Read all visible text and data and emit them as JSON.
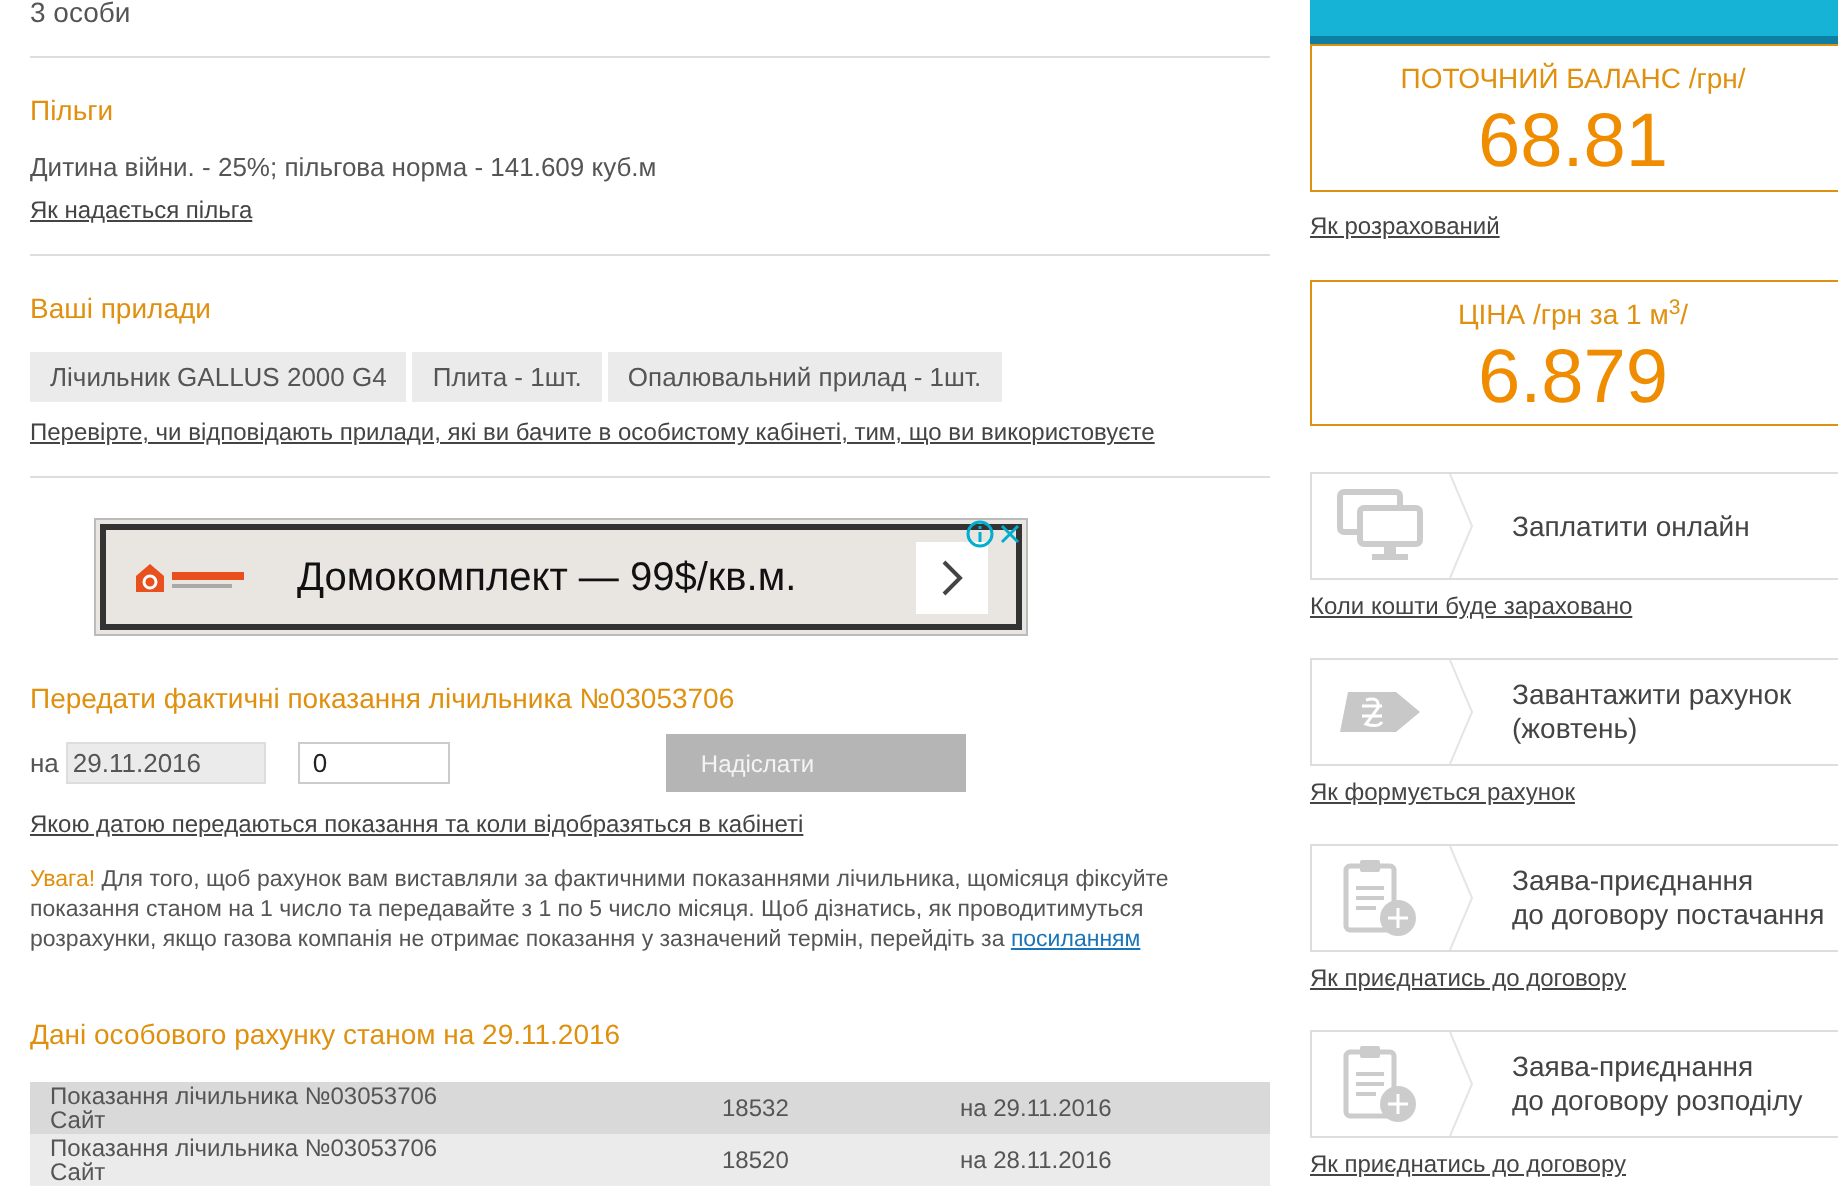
{
  "household": {
    "text": "3 особи"
  },
  "benefits": {
    "title": "Пільги",
    "text": "Дитина війни. - 25%; пільгова норма - 141.609 куб.м",
    "link": "Як надається пільга"
  },
  "devices": {
    "title": "Ваші прилади",
    "items": [
      "Лічильник GALLUS 2000 G4",
      "Плита - 1шт.",
      "Опалювальний прилад - 1шт."
    ],
    "link": "Перевірте, чи відповідають прилади, які ви бачите в особистому кабінеті, тим, що ви використовуєте"
  },
  "ad": {
    "text": "Домокомплект — 99$/кв.м."
  },
  "reading_form": {
    "title": "Передати фактичні показання лічильника №03053706",
    "date_label": "на",
    "date": "29.11.2016",
    "value": "0",
    "button": "Надіслати",
    "button_disabled": true,
    "link": "Якою датою передаються показання та коли відобразяться в кабінеті"
  },
  "warning": {
    "label": "Увага!",
    "text": " Для того, щоб рахунок вам виставляли за фактичними показаннями лічильника, щомісяця фіксуйте показання станом на 1 число та передавайте з 1 по 5 число місяця. Щоб дізнатись, як проводитимуться розрахунки, якщо газова компанія не отримає показання у зазначений термін, перейдіть за ",
    "link": "посиланням"
  },
  "account": {
    "title": "Дані особового рахунку станом на 29.11.2016",
    "rows": [
      {
        "meter": "Показання лічильника №03053706",
        "source": "Сайт",
        "reading": "18532",
        "date": "на 29.11.2016"
      },
      {
        "meter": "Показання лічильника №03053706",
        "source": "Сайт",
        "reading": "18520",
        "date": "на 28.11.2016"
      }
    ]
  },
  "balance": {
    "label": "ПОТОЧНИЙ БАЛАНС /грн/",
    "value": "68.81",
    "link": "Як розрахований"
  },
  "price": {
    "label": "ЦІНА /грн за 1 м$^{3}$/",
    "value": "6.879"
  },
  "actions": [
    {
      "kind": "monitor",
      "label": [
        "Заплатити онлайн"
      ],
      "link": "Коли кошти буде зараховано"
    },
    {
      "kind": "currency",
      "label": [
        "Завантажити рахунок",
        "(жовтень)"
      ],
      "link": "Як формується рахунок"
    },
    {
      "kind": "clipboard",
      "label": [
        "Заява-приєднання",
        "до договору постачання"
      ],
      "link": "Як приєднатись до договору"
    },
    {
      "kind": "clipboard",
      "label": [
        "Заява-приєднання",
        "до договору розподілу"
      ],
      "link": "Як приєднатись до договору"
    }
  ]
}
